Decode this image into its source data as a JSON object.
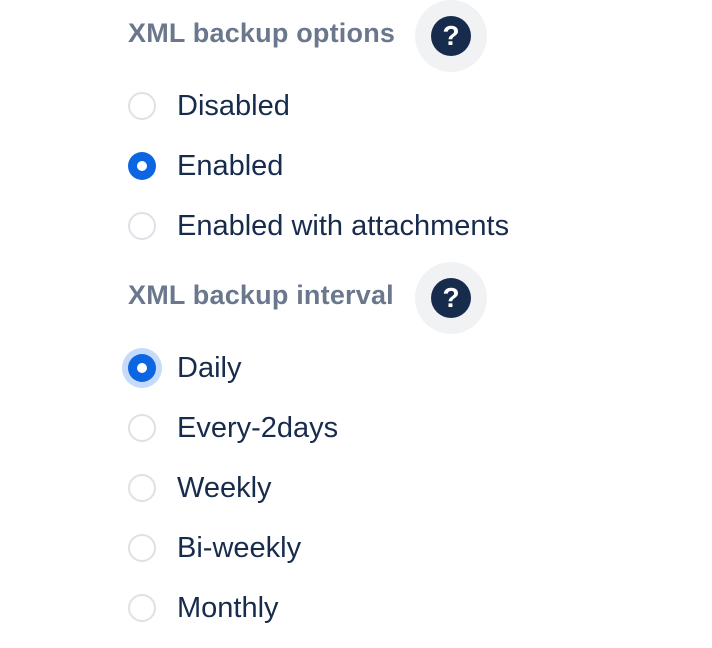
{
  "backup_options": {
    "title": "XML backup options",
    "help_icon_glyph": "?",
    "items": [
      {
        "label": "Disabled",
        "selected": false
      },
      {
        "label": "Enabled",
        "selected": true
      },
      {
        "label": "Enabled with attachments",
        "selected": false
      }
    ]
  },
  "backup_interval": {
    "title": "XML backup interval",
    "help_icon_glyph": "?",
    "items": [
      {
        "label": "Daily",
        "selected": true,
        "focused": true
      },
      {
        "label": "Every-2days",
        "selected": false
      },
      {
        "label": "Weekly",
        "selected": false
      },
      {
        "label": "Bi-weekly",
        "selected": false
      },
      {
        "label": "Monthly",
        "selected": false
      }
    ]
  },
  "colors": {
    "accent": "#0c66e4",
    "section_title": "#6b778c",
    "label_text": "#172b4d",
    "help_icon_bg": "#172b4d",
    "help_button_bg": "#f1f2f4",
    "radio_border": "#dfe1e6",
    "focus_ring": "#c6dbfa"
  }
}
